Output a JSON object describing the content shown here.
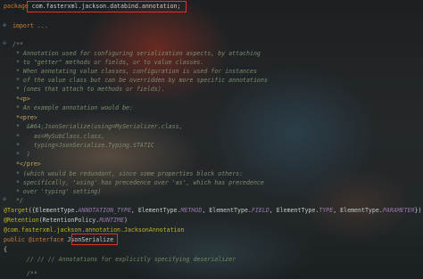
{
  "code": {
    "package_kw": "package",
    "package_name": "com.fasterxml.jackson.databind.annotation;",
    "import_line": "import ...",
    "doc_open": "/**",
    "doc1": " * Annotation used for configuring serialization aspects, by attaching",
    "doc2": " * to \"getter\" methods or fields, or to value classes.",
    "doc3": " * When annotating value classes, configuration is used for instances",
    "doc4": " * of the value class but can be overridden by more specific annotations",
    "doc5": " * (ones that attach to methods or fields).",
    "doc6": " *<p>",
    "doc7": " * An example annotation would be:",
    "doc8": " *<pre>",
    "doc9": " *  &#64;JsonSerialize(using=MySerializer.class,",
    "doc10": " *    as=MySubClass.class,",
    "doc11": " *    typing=JsonSerialize.Typing.STATIC",
    "doc12": " *  )",
    "doc13": " *</pre>",
    "doc14": " * (which would be redundant, since some properties block others:",
    "doc15": " * specifically, 'using' has precedence over 'as', which has precedence",
    "doc16": " * over 'typing' setting)",
    "doc_close": " */",
    "target_annot": "@Target",
    "target_open": "({ElementType.",
    "target_e1": "ANNOTATION_TYPE",
    "target_sep1": ", ElementType.",
    "target_e2": "METHOD",
    "target_sep2": ", ElementType.",
    "target_e3": "FIELD",
    "target_sep3": ", ElementType.",
    "target_e4": "TYPE",
    "target_sep4": ", ElementType.",
    "target_e5": "PARAMETER",
    "target_close": "})",
    "retention_annot": "@Retention",
    "retention_open": "(RetentionPolicy.",
    "retention_val": "RUNTIME",
    "retention_close": ")",
    "jackson_annot": "@com.fasterxml.jackson.annotation.JacksonAnnotation",
    "decl_kw": "public @interface",
    "decl_name": "JsonSerialize",
    "brace_open": "{",
    "inner_comment": "    // // // Annotations for explicitly specifying deserializer",
    "inner_doc": "    /**"
  },
  "colors": {
    "keyword": "#cc7832",
    "annotation": "#bbb529",
    "enum_constant": "#9876aa",
    "doc_comment": "#7f8a6c",
    "highlight_box": "#e0312f"
  }
}
